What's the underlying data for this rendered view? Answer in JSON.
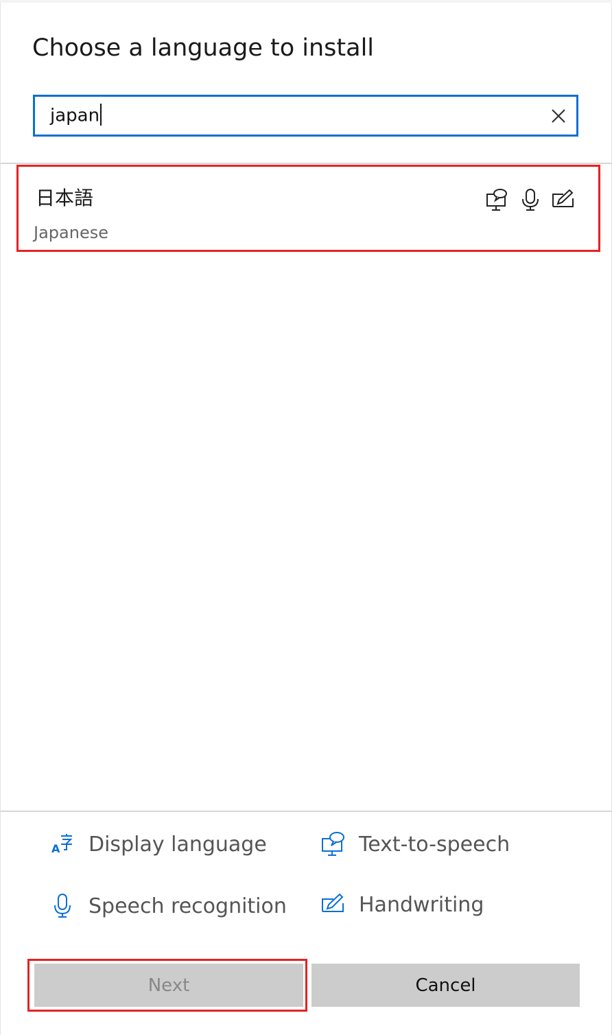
{
  "dialog": {
    "title": "Choose a language to install"
  },
  "search": {
    "value": "japan",
    "clear_icon": "close-icon"
  },
  "results": [
    {
      "native_name": "日本語",
      "english_name": "Japanese",
      "features": [
        "text-to-speech-icon",
        "microphone-icon",
        "handwriting-icon"
      ]
    }
  ],
  "legend": {
    "display_language": "Display language",
    "text_to_speech": "Text-to-speech",
    "speech_recognition": "Speech recognition",
    "handwriting": "Handwriting"
  },
  "buttons": {
    "next_label": "Next",
    "cancel_label": "Cancel"
  },
  "colors": {
    "accent": "#0a6fd3",
    "highlight": "#e52222",
    "button_bg": "#cccccc"
  }
}
